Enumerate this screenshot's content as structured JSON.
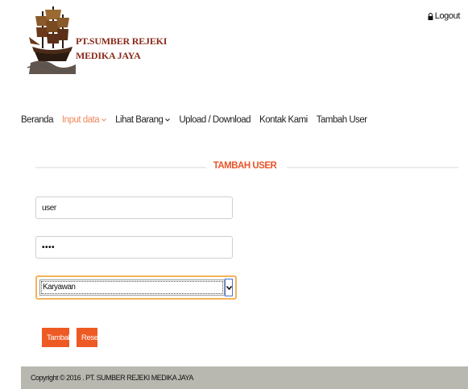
{
  "brand": {
    "line1": "PT.SUMBER REJEKI",
    "line2": "MEDIKA JAYA",
    "logo_icon": "ship-icon"
  },
  "header": {
    "logout_label": "Logout",
    "logout_icon": "lock-icon"
  },
  "nav": {
    "items": [
      {
        "label": "Beranda",
        "active": false,
        "dropdown": false
      },
      {
        "label": "Input data",
        "active": true,
        "dropdown": true
      },
      {
        "label": "Lihat Barang",
        "active": false,
        "dropdown": true
      },
      {
        "label": "Upload / Download",
        "active": false,
        "dropdown": false
      },
      {
        "label": "Kontak Kami",
        "active": false,
        "dropdown": false
      },
      {
        "label": "Tambah User",
        "active": false,
        "dropdown": false
      }
    ]
  },
  "form": {
    "title": "TAMBAH USER",
    "username_value": "user",
    "password_value": "••••",
    "role_selected": "Karyawan",
    "submit_label": "Tambah",
    "reset_label": "Reset"
  },
  "footer": {
    "text": "Copyright © 2016 . PT. SUMBER REJEKI MEDIKA JAYA"
  },
  "colors": {
    "accent": "#ee5a24",
    "active_nav": "#f08a5d",
    "footer_bg": "#b8b8b0",
    "focus_border": "#f4b35a"
  }
}
